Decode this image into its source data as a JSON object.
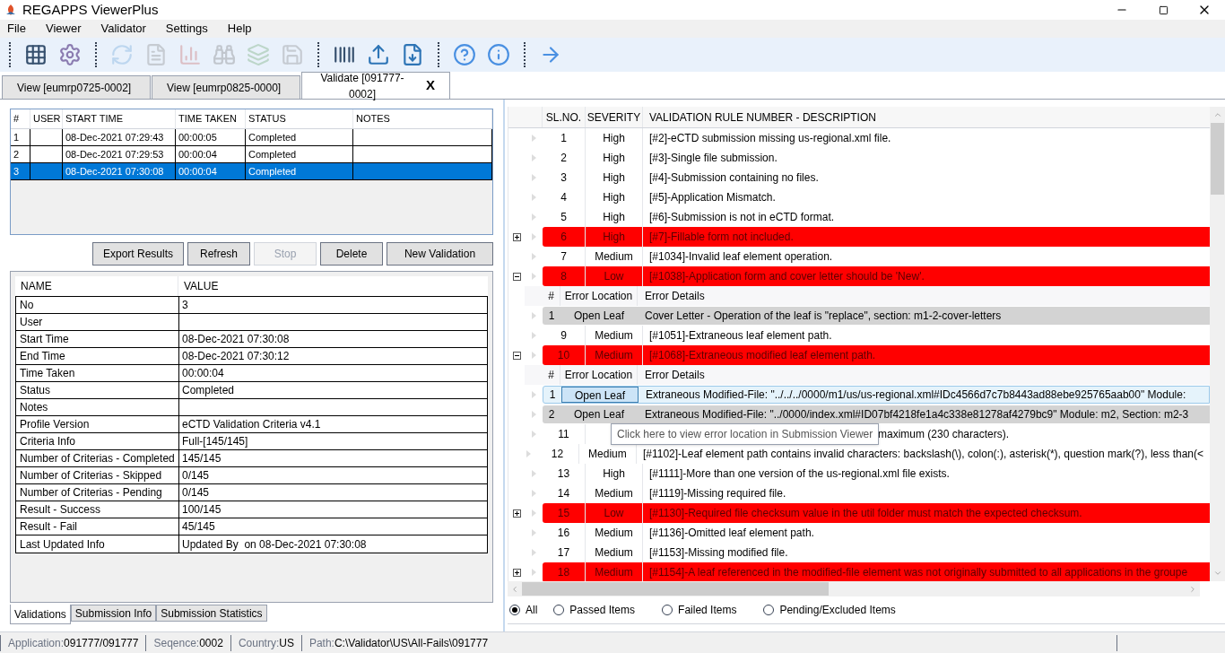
{
  "window": {
    "title": "REGAPPS ViewerPlus"
  },
  "menu": [
    "File",
    "Viewer",
    "Validator",
    "Settings",
    "Help"
  ],
  "toolbar": [
    {
      "kind": "separator"
    },
    {
      "kind": "grid",
      "disabled": false
    },
    {
      "kind": "gear",
      "disabled": false
    },
    {
      "kind": "separator"
    },
    {
      "kind": "refresh",
      "disabled": true
    },
    {
      "kind": "report",
      "disabled": true
    },
    {
      "kind": "chart",
      "disabled": true
    },
    {
      "kind": "binoculars",
      "disabled": true
    },
    {
      "kind": "stack",
      "disabled": true
    },
    {
      "kind": "save",
      "disabled": true
    },
    {
      "kind": "separator"
    },
    {
      "kind": "barcode",
      "disabled": false
    },
    {
      "kind": "upload",
      "disabled": false
    },
    {
      "kind": "download",
      "disabled": false
    },
    {
      "kind": "separator"
    },
    {
      "kind": "help",
      "disabled": false
    },
    {
      "kind": "info",
      "disabled": false
    },
    {
      "kind": "separator"
    },
    {
      "kind": "exit",
      "disabled": false
    }
  ],
  "tabs": [
    {
      "label": "View [eumrp0725-0002]",
      "selected": false
    },
    {
      "label": "View [eumrp0825-0000]",
      "selected": false
    },
    {
      "label": "Validate [091777-0002]",
      "selected": true,
      "close": "X"
    }
  ],
  "validations": {
    "columns": [
      "#",
      "USER",
      "START TIME",
      "TIME TAKEN",
      "STATUS",
      "NOTES"
    ],
    "rows": [
      {
        "cells": [
          "1",
          "",
          "08-Dec-2021 07:29:43",
          "00:00:05",
          "Completed",
          ""
        ],
        "selected": false
      },
      {
        "cells": [
          "2",
          "",
          "08-Dec-2021 07:29:53",
          "00:00:04",
          "Completed",
          ""
        ],
        "selected": false
      },
      {
        "cells": [
          "3",
          "",
          "08-Dec-2021 07:30:08",
          "00:00:04",
          "Completed",
          ""
        ],
        "selected": true
      }
    ]
  },
  "buttons": [
    {
      "label": "Export Results",
      "disabled": false
    },
    {
      "label": "Refresh",
      "disabled": false
    },
    {
      "label": "Stop",
      "disabled": true
    },
    {
      "label": "Delete",
      "disabled": false
    },
    {
      "label": "New Validation",
      "disabled": false
    }
  ],
  "properties": {
    "columns": [
      "NAME",
      "VALUE"
    ],
    "rows": [
      {
        "name": "No",
        "value": "3"
      },
      {
        "name": "User",
        "value": ""
      },
      {
        "name": "Start Time",
        "value": "08-Dec-2021 07:30:08"
      },
      {
        "name": "End Time",
        "value": "08-Dec-2021 07:30:12"
      },
      {
        "name": "Time Taken",
        "value": "00:00:04"
      },
      {
        "name": "Status",
        "value": "Completed"
      },
      {
        "name": "Notes",
        "value": ""
      },
      {
        "name": "Profile Version",
        "value": "eCTD Validation Criteria v4.1"
      },
      {
        "name": "Criteria Info",
        "value": "Full-[145/145]"
      },
      {
        "name": "Number of Criterias - Completed",
        "value": "145/145"
      },
      {
        "name": "Number of Criterias - Skipped",
        "value": "0/145"
      },
      {
        "name": "Number of Criterias - Pending",
        "value": "0/145"
      },
      {
        "name": "Result - Success",
        "value": "100/145"
      },
      {
        "name": "Result - Fail",
        "value": "45/145"
      },
      {
        "name": "Last Updated Info",
        "value": "Updated By  on 08-Dec-2021 07:30:08"
      }
    ]
  },
  "bottom_tabs": [
    {
      "label": "Validations",
      "selected": true
    },
    {
      "label": "Submission Info",
      "selected": false
    },
    {
      "label": "Submission Statistics",
      "selected": false
    }
  ],
  "results": {
    "columns": [
      "SL.NO.",
      "SEVERITY",
      "VALIDATION RULE NUMBER - DESCRIPTION"
    ],
    "rows": [
      {
        "kind": "rule",
        "sl": "1",
        "severity": "High",
        "description": "[#2]-eCTD submission missing us-regional.xml file.",
        "failed": false
      },
      {
        "kind": "rule",
        "sl": "2",
        "severity": "High",
        "description": "[#3]-Single file submission.",
        "failed": false
      },
      {
        "kind": "rule",
        "sl": "3",
        "severity": "High",
        "description": "[#4]-Submission containing no files.",
        "failed": false
      },
      {
        "kind": "rule",
        "sl": "4",
        "severity": "High",
        "description": "[#5]-Application Mismatch.",
        "failed": false
      },
      {
        "kind": "rule",
        "sl": "5",
        "severity": "High",
        "description": "[#6]-Submission is not in eCTD format.",
        "failed": false
      },
      {
        "kind": "rule",
        "sl": "6",
        "severity": "High",
        "description": "[#7]-Fillable form not included.",
        "failed": true,
        "expanded": false
      },
      {
        "kind": "rule",
        "sl": "7",
        "severity": "Medium",
        "description": "[#1034]-Invalid leaf element operation.",
        "failed": false
      },
      {
        "kind": "rule",
        "sl": "8",
        "severity": "Low",
        "description": "[#1038]-Application form and cover letter should be 'New'.",
        "failed": true,
        "expanded": true
      },
      {
        "kind": "subheader",
        "columns": [
          "#",
          "Error Location",
          "Error Details"
        ]
      },
      {
        "kind": "sub",
        "index": "1",
        "location": "Open Leaf",
        "details": "Cover Letter - Operation of the leaf is \"replace\", section: m1-2-cover-letters",
        "selected": false
      },
      {
        "kind": "rule",
        "sl": "9",
        "severity": "Medium",
        "description": "[#1051]-Extraneous leaf element path.",
        "failed": false
      },
      {
        "kind": "rule",
        "sl": "10",
        "severity": "Medium",
        "description": "[#1068]-Extraneous modified leaf element path.",
        "failed": true,
        "expanded": true
      },
      {
        "kind": "subheader",
        "columns": [
          "#",
          "Error Location",
          "Error Details"
        ]
      },
      {
        "kind": "sub",
        "index": "1",
        "location": "Open Leaf",
        "details": "Extraneous Modified-File: \"../../../0000/m1/us/us-regional.xml#IDc4566d7c7b8443ad88ebe925765aab00\" Module:",
        "selected": true
      },
      {
        "kind": "sub",
        "index": "2",
        "location": "Open Leaf",
        "details": "Extraneous Modified-File: \"../0000/index.xml#ID07bf4218fe1a4c338e81278af4279bc9\" Module: m2, Section: m2-3",
        "selected": false
      },
      {
        "kind": "partial",
        "sl": "11",
        "description": "maximum (230 characters).",
        "failed": false
      },
      {
        "kind": "rule",
        "sl": "12",
        "severity": "Medium",
        "description": "[#1102]-Leaf element path contains invalid characters: backslash(\\), colon(:), asterisk(*), question mark(?), less than(<",
        "failed": false
      },
      {
        "kind": "rule",
        "sl": "13",
        "severity": "High",
        "description": "[#1111]-More than one version of the us-regional.xml file exists.",
        "failed": false
      },
      {
        "kind": "rule",
        "sl": "14",
        "severity": "Medium",
        "description": "[#1119]-Missing required file.",
        "failed": false
      },
      {
        "kind": "rule",
        "sl": "15",
        "severity": "Low",
        "description": "[#1130]-Required file checksum value in the util folder must match the expected checksum.",
        "failed": true,
        "expanded": false
      },
      {
        "kind": "rule",
        "sl": "16",
        "severity": "Medium",
        "description": "[#1136]-Omitted leaf element path.",
        "failed": false
      },
      {
        "kind": "rule",
        "sl": "17",
        "severity": "Medium",
        "description": "[#1153]-Missing modified file.",
        "failed": false
      },
      {
        "kind": "rule",
        "sl": "18",
        "severity": "Medium",
        "description": "[#1154]-A leaf referenced in the modified-file element was not originally submitted to all applications in the groupe",
        "failed": true,
        "expanded": false
      }
    ],
    "tooltip": "Click here to view error location in Submission Viewer"
  },
  "filters": [
    {
      "label": "All",
      "selected": true
    },
    {
      "label": "Passed Items",
      "selected": false
    },
    {
      "label": "Failed Items",
      "selected": false
    },
    {
      "label": "Pending/Excluded Items",
      "selected": false
    }
  ],
  "status_bar": [
    {
      "label": "Application:",
      "value": "091777/091777"
    },
    {
      "label": "Seqence:",
      "value": "0002"
    },
    {
      "label": "Country:",
      "value": "US"
    },
    {
      "label": "Path:",
      "value": "C:\\Validator\\US\\All-Fails\\091777"
    }
  ]
}
